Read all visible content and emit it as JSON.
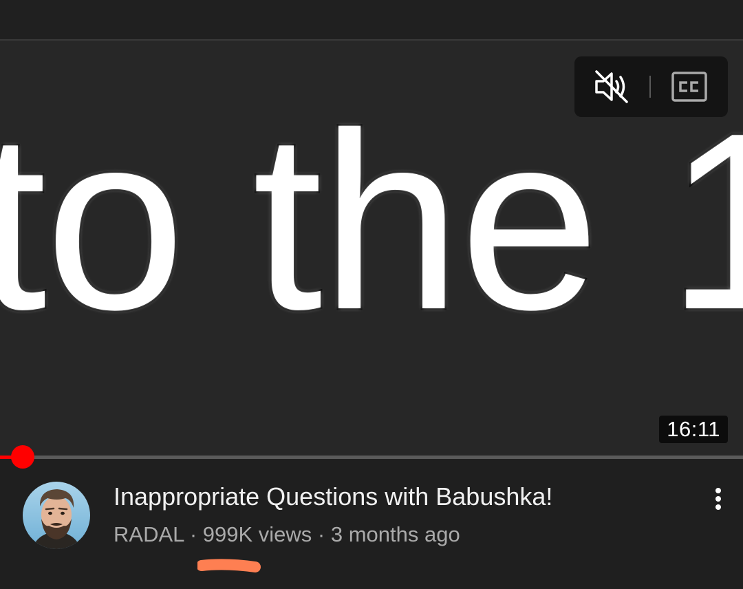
{
  "player": {
    "overlay_text": "to the 1",
    "duration": "16:11",
    "progress": 0.031,
    "controls": {
      "mute_icon": "volume-muted-icon",
      "cc_icon": "closed-captions-icon",
      "cc_label": "CC"
    }
  },
  "video": {
    "title": "Inappropriate Questions with Babushka!",
    "channel": "RADAL",
    "separator": " · ",
    "views": "999K views",
    "age": "3 months ago",
    "more_icon": "more-vertical-icon"
  },
  "colors": {
    "background": "#1f1f1f",
    "player_bg": "#272727",
    "progress_red": "#ff0000",
    "title": "#f1f1f1",
    "meta": "#aaaaaa",
    "annotation_orange": "#fe7f52"
  }
}
